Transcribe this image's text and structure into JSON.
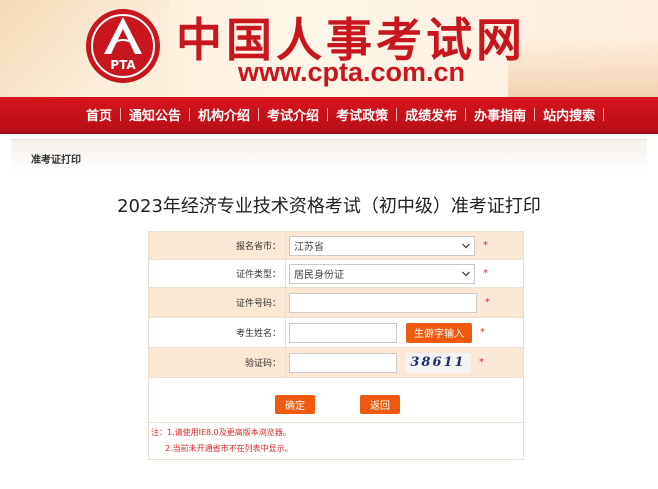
{
  "site": {
    "title": "中国人事考试网",
    "url": "www.cpta.com.cn",
    "logo_text": "PTA"
  },
  "nav": {
    "items": [
      {
        "label": "首页"
      },
      {
        "label": "通知公告"
      },
      {
        "label": "机构介绍"
      },
      {
        "label": "考试介绍"
      },
      {
        "label": "考试政策"
      },
      {
        "label": "成绩发布"
      },
      {
        "label": "办事指南"
      },
      {
        "label": "站内搜索"
      }
    ]
  },
  "breadcrumb": "准考证打印",
  "page_title": "2023年经济专业技术资格考试（初中级）准考证打印",
  "form": {
    "province_label": "报名省市：",
    "province_value": "江苏省",
    "id_type_label": "证件类型：",
    "id_type_value": "居民身份证",
    "id_number_label": "证件号码：",
    "name_label": "考生姓名：",
    "rare_char_button": "生僻字输入",
    "captcha_label": "验证码：",
    "captcha_text": "38611",
    "required_mark": "*",
    "confirm_button": "确定",
    "back_button": "返回",
    "note_1": "注：1.请使用IE8.0及更高版本浏览器。",
    "note_2": "2.当前未开通省市不在列表中显示。"
  },
  "colors": {
    "brand_red": "#c8161d",
    "nav_red": "#d8141b",
    "button_orange": "#ef5a10",
    "row_beige": "#fbe8d4"
  }
}
